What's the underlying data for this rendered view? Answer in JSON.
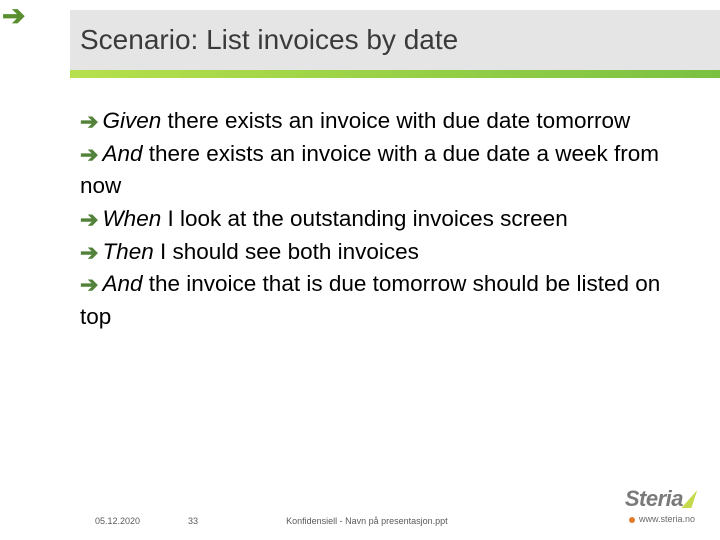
{
  "header": {
    "title": "Scenario: List invoices by date"
  },
  "bullets": [
    {
      "keyword": "Given",
      "text": " there exists an invoice with due date tomorrow"
    },
    {
      "keyword": "And",
      "text": " there exists an invoice with a due date a week from now"
    },
    {
      "keyword": "When",
      "text": " I look at the outstanding invoices screen"
    },
    {
      "keyword": "Then",
      "text": " I should see both invoices"
    },
    {
      "keyword": "And",
      "text": " the invoice that is due tomorrow should be listed on top"
    }
  ],
  "footer": {
    "date": "05.12.2020",
    "page": "33",
    "confidential": "Konfidensiell - Navn på presentasjon.ppt",
    "site": "www.steria.no",
    "logo_name": "Steria"
  },
  "glyphs": {
    "arrow": "➔"
  }
}
